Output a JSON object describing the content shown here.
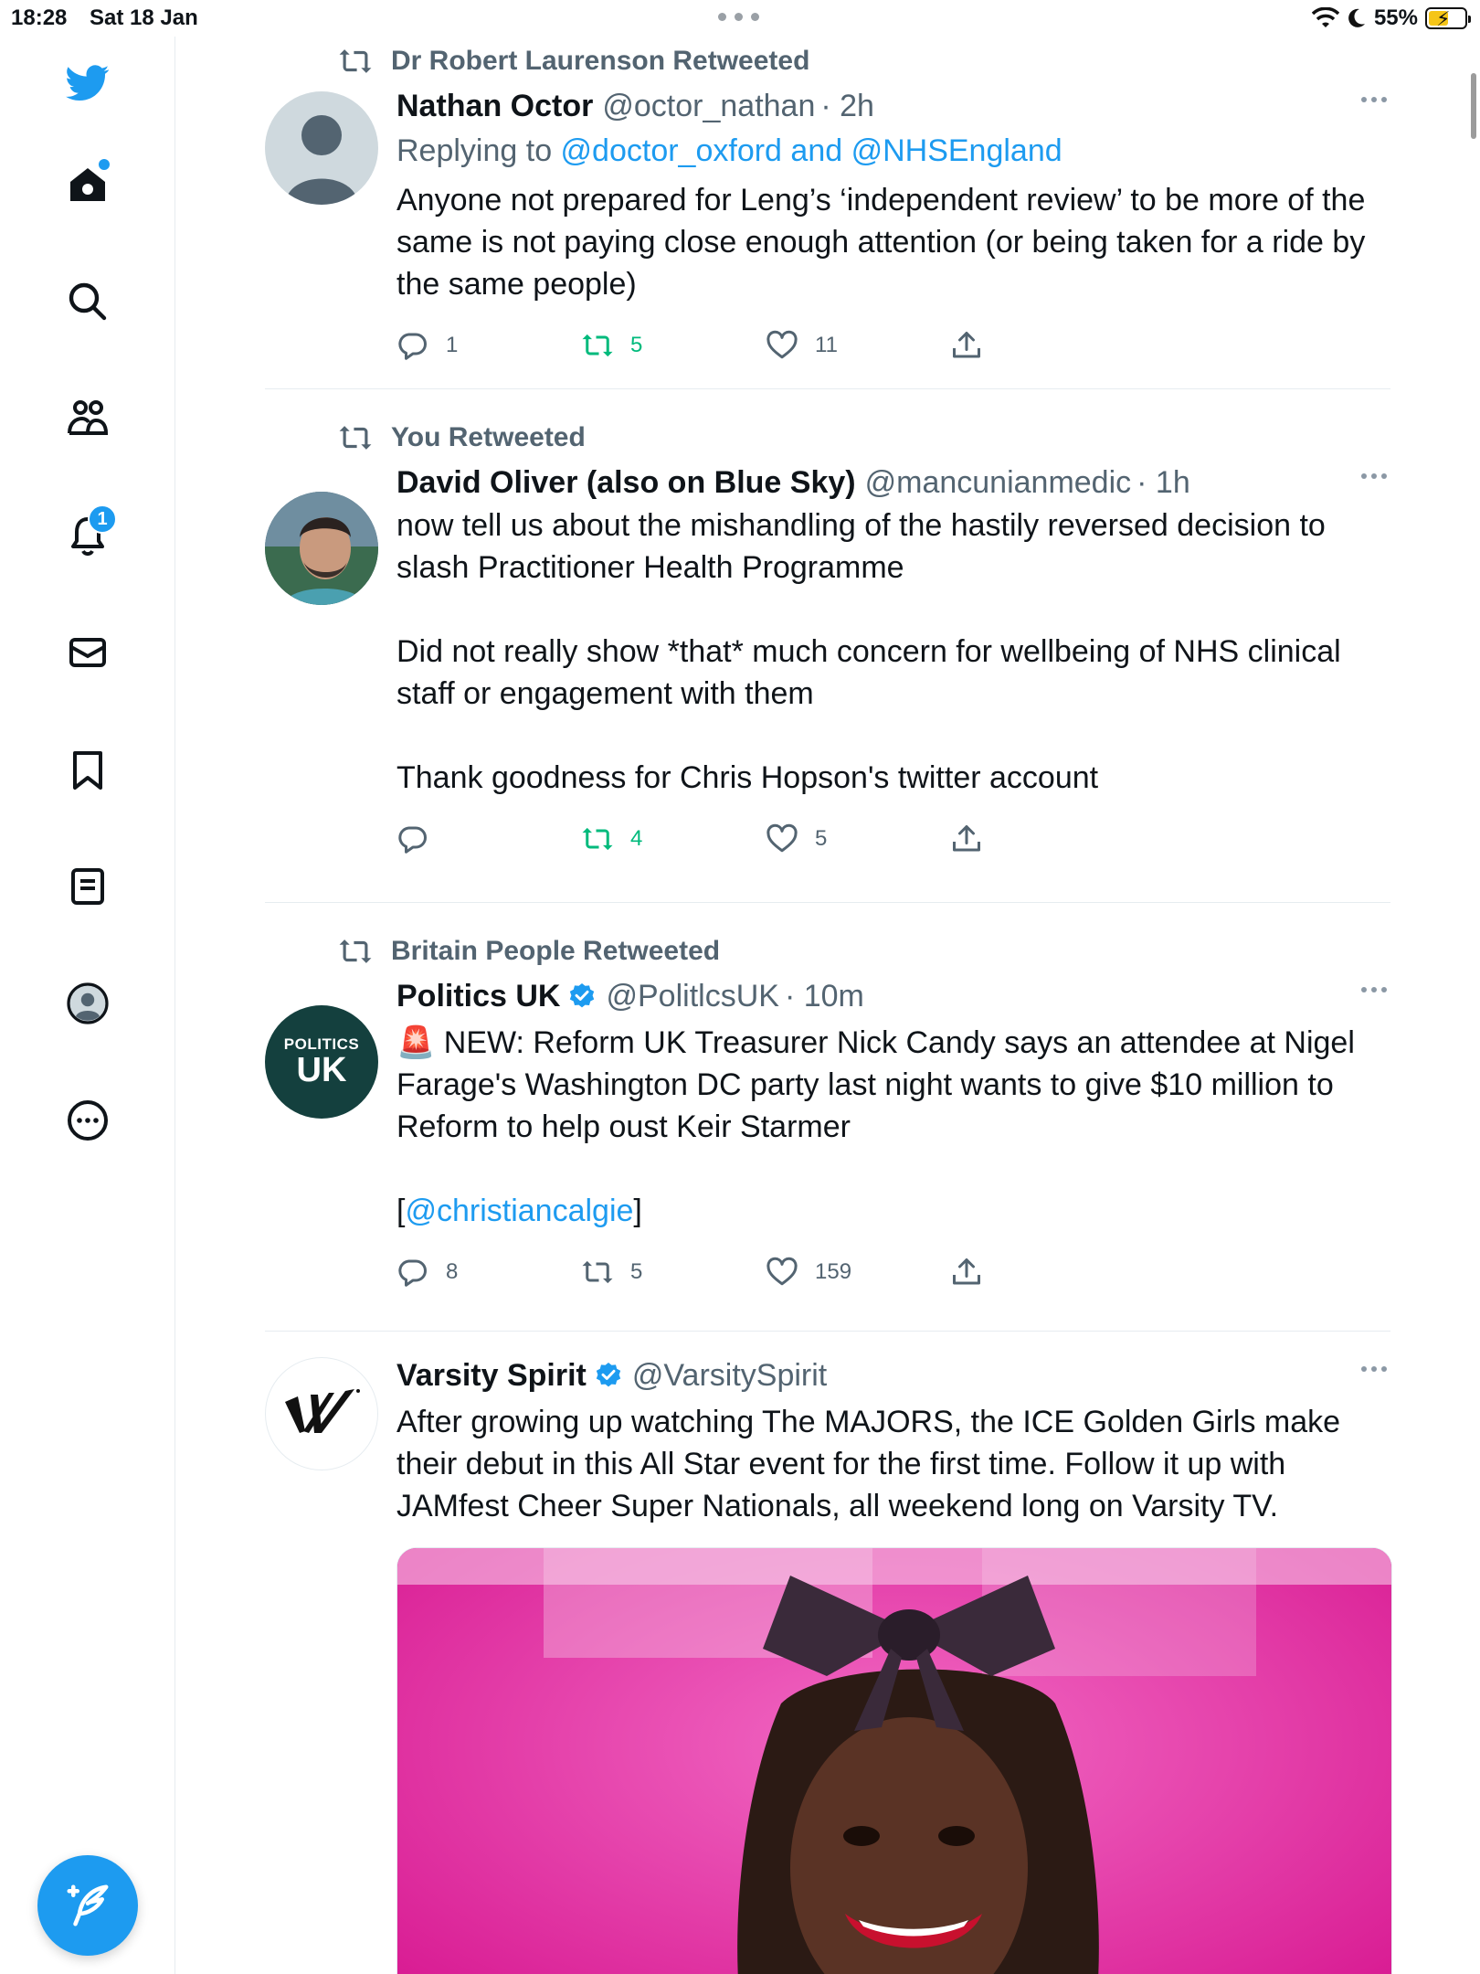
{
  "status_bar": {
    "time": "18:28",
    "date": "Sat 18 Jan",
    "battery_percent": "55%",
    "battery_level": 0.55
  },
  "sidebar": {
    "items": [
      {
        "name": "twitter-logo-icon"
      },
      {
        "name": "home-icon",
        "has_dot": true
      },
      {
        "name": "search-icon"
      },
      {
        "name": "communities-icon"
      },
      {
        "name": "notifications-icon",
        "badge": "1"
      },
      {
        "name": "messages-icon"
      },
      {
        "name": "bookmarks-icon"
      },
      {
        "name": "lists-icon"
      },
      {
        "name": "profile-icon"
      },
      {
        "name": "more-icon"
      }
    ],
    "compose_icon": "compose-tweet-icon"
  },
  "colors": {
    "accent": "#1d9bf0",
    "retweet_green": "#00ba7c",
    "secondary_text": "#536471",
    "divider": "#e6ecf0"
  },
  "tweets": [
    {
      "retweeted_by": "Dr Robert Laurenson Retweeted",
      "name": "Nathan Octor",
      "handle": "@octor_nathan",
      "time": "· 2h",
      "replying_prefix": "Replying to ",
      "replying_to": "@doctor_oxford and @NHSEngland",
      "text": [
        "Anyone not prepared for Leng’s ‘independent review’ to be more of the same is not paying close enough attention (or being taken for a ride by the same people)"
      ],
      "replies": "1",
      "retweets": "5",
      "likes": "11"
    },
    {
      "retweeted_by": "You Retweeted",
      "name": "David Oliver (also on Blue Sky)",
      "handle": "@mancunianmedic",
      "time": "· 1h",
      "text": [
        "now tell us about the mishandling of the hastily reversed decision to slash Practitioner Health Programme",
        "",
        "Did not really show *that* much concern for wellbeing of NHS clinical staff or engagement with them",
        "",
        "Thank goodness for Chris Hopson's twitter account"
      ],
      "replies": "",
      "retweets": "4",
      "likes": "5"
    },
    {
      "retweeted_by": "Britain People Retweeted",
      "name": "Politics UK",
      "handle": "@PolitlcsUK",
      "time": "· 10m",
      "avatar_text_top": "POLITICS",
      "avatar_text_bottom": "UK",
      "text": [
        "🚨 NEW: Reform UK Treasurer Nick Candy says an attendee at Nigel Farage's Washington DC party last night wants to give $10 million to Reform to help oust Keir Starmer",
        ""
      ],
      "mention_open": "[",
      "mention": "@christiancalgie",
      "mention_close": "]",
      "replies": "8",
      "retweets": "5",
      "likes": "159"
    },
    {
      "name": "Varsity Spirit",
      "handle": "@VarsitySpirit",
      "text": [
        "After growing up watching The MAJORS, the ICE Golden Girls make their debut in this All Star event for the first time. Follow it up with JAMfest Cheer Super Nationals, all weekend long on Varsity TV."
      ]
    }
  ]
}
